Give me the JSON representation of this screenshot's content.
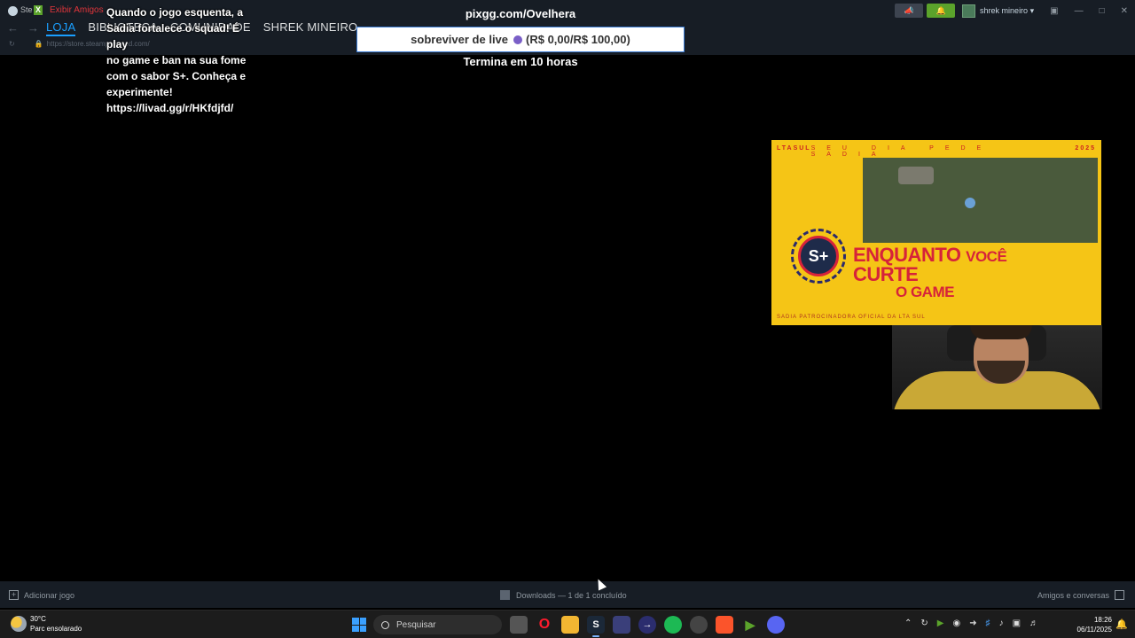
{
  "steam": {
    "menu_word": "Ste",
    "red_label": "Exibir Amigos",
    "nav_tabs": [
      "LOJA",
      "BIBLIOTECA",
      "COMUNIDADE",
      "SHREK MINEIRO"
    ],
    "url": "https://store.steampowered.com/",
    "username": "shrek mineiro",
    "bottom_left": "Adicionar jogo",
    "bottom_center": "Downloads — 1 de 1 concluído",
    "bottom_right": "Amigos e conversas"
  },
  "overlay": {
    "chat_message": "Quando o jogo esquenta, a Sadia fortalece o squad! É play no game e ban na sua fome com o sabor S+. Conheça e experimente! https://livad.gg/r/HKfdjfd/",
    "chat_lines": [
      "Quando o jogo esquenta, a",
      "Sadia fortalece o squad! É play",
      "no game e ban na sua fome",
      "com o sabor S+. Conheça e",
      "experimente!",
      "https://livad.gg/r/HKfdjfd/"
    ],
    "pix_url": "pixgg.com/Ovelhera",
    "goal_text": "sobreviver de live",
    "goal_amount": "(R$ 0,00/R$ 100,00)",
    "goal_timer": "Termina em 10 horas"
  },
  "ad": {
    "top_left": "LTASUL",
    "top_mid": "SEU DIA PEDE SADIA",
    "top_right": "2025",
    "seal_text": "S+",
    "headline_1": "ENQUANTO",
    "headline_1b": "VOCÊ",
    "headline_2": "CURTE",
    "headline_3": "O GAME",
    "foot_text": "SADIA PATROCINADORA OFICIAL DA LTA SUL"
  },
  "taskbar": {
    "temp": "30°C",
    "weather": "Parc ensolarado",
    "search_placeholder": "Pesquisar",
    "time": "18:26",
    "date": "06/11/2025"
  },
  "colors": {
    "steam_bg": "#171d25",
    "steam_accent": "#1a9fff",
    "ad_yellow": "#f5c516",
    "ad_red": "#d6233a"
  }
}
